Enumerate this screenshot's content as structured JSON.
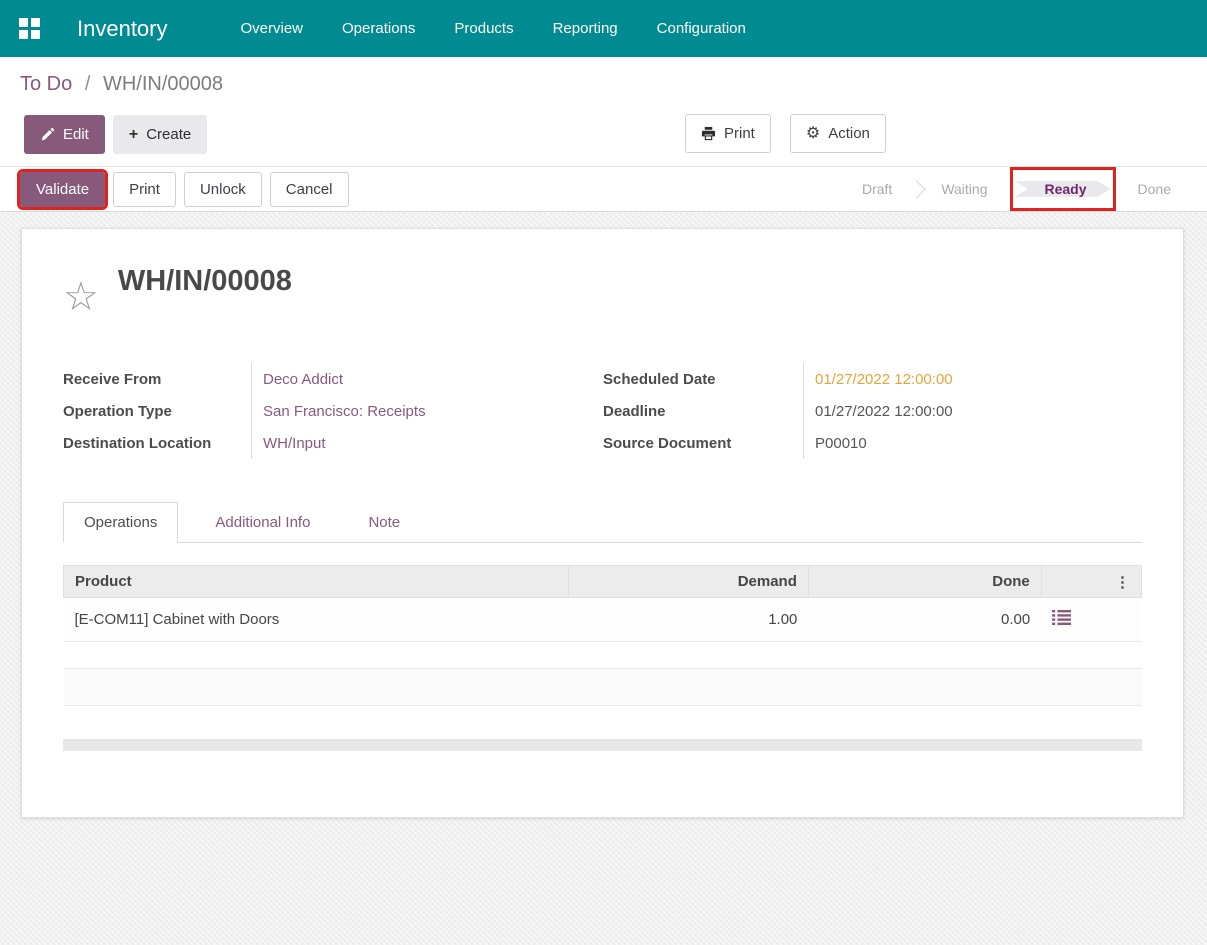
{
  "colors": {
    "nav_teal": "#008b92",
    "brand_purple": "#875A7B",
    "highlight_red": "#e0231e",
    "warning_orange": "#e8a33d",
    "stage_active_purple": "#71266b"
  },
  "nav": {
    "brand": "Inventory",
    "items": [
      {
        "label": "Overview"
      },
      {
        "label": "Operations"
      },
      {
        "label": "Products"
      },
      {
        "label": "Reporting"
      },
      {
        "label": "Configuration"
      }
    ]
  },
  "breadcrumb": {
    "parent": "To Do",
    "separator": "/",
    "current": "WH/IN/00008"
  },
  "doc_actions": {
    "edit": "Edit",
    "create": "Create",
    "print": "Print",
    "action": "Action"
  },
  "statusbar": {
    "buttons": [
      {
        "label": "Validate",
        "style": "primary",
        "highlighted": true
      },
      {
        "label": "Print"
      },
      {
        "label": "Unlock"
      },
      {
        "label": "Cancel"
      }
    ],
    "stages": [
      {
        "label": "Draft"
      },
      {
        "label": "Waiting"
      },
      {
        "label": "Ready",
        "active": true,
        "highlighted": true
      },
      {
        "label": "Done"
      }
    ]
  },
  "form": {
    "title": "WH/IN/00008",
    "fields_left": [
      {
        "label": "Receive From",
        "value": "Deco Addict"
      },
      {
        "label": "Operation Type",
        "value": "San Francisco: Receipts"
      },
      {
        "label": "Destination Location",
        "value": "WH/Input"
      }
    ],
    "fields_right": [
      {
        "label": "Scheduled Date",
        "value": "01/27/2022 12:00:00",
        "warning": true
      },
      {
        "label": "Deadline",
        "value": "01/27/2022 12:00:00"
      },
      {
        "label": "Source Document",
        "value": "P00010"
      }
    ]
  },
  "tabs": [
    {
      "label": "Operations",
      "active": true
    },
    {
      "label": "Additional Info"
    },
    {
      "label": "Note"
    }
  ],
  "operations_table": {
    "columns": {
      "product": "Product",
      "demand": "Demand",
      "done": "Done"
    },
    "rows": [
      {
        "product": "[E-COM11] Cabinet with Doors",
        "demand": "1.00",
        "done": "0.00"
      }
    ]
  }
}
